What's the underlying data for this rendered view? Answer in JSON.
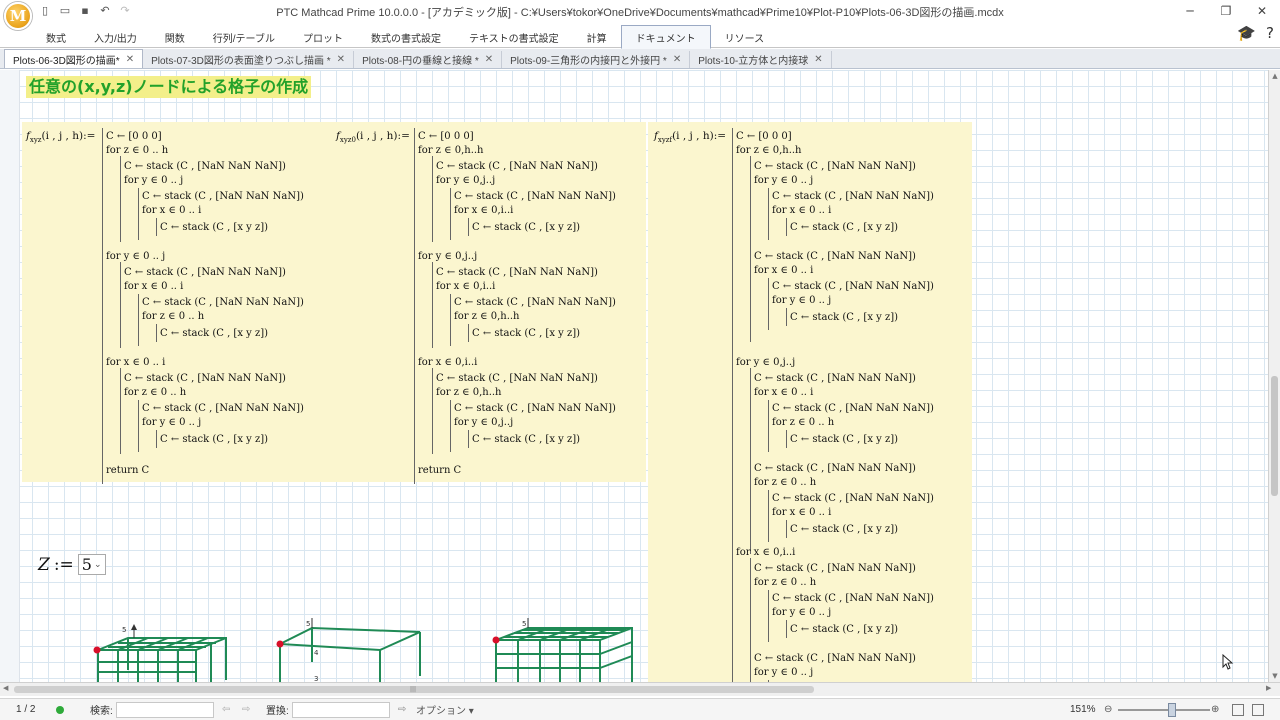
{
  "window": {
    "title": "PTC Mathcad Prime 10.0.0.0 - [アカデミック版] - C:¥Users¥tokor¥OneDrive¥Documents¥mathcad¥Prime10¥Plot-P10¥Plots-06-3D図形の描画.mcdx",
    "logo_letter": "M"
  },
  "ribbon": {
    "tabs": [
      "数式",
      "入力/出力",
      "関数",
      "行列/テーブル",
      "プロット",
      "数式の書式設定",
      "テキストの書式設定",
      "計算",
      "ドキュメント",
      "リソース"
    ],
    "active_tab": "ドキュメント"
  },
  "doc_tabs": [
    {
      "label": "Plots-06-3D図形の描画*",
      "active": true
    },
    {
      "label": "Plots-07-3D図形の表面塗りつぶし描画 *",
      "active": false
    },
    {
      "label": "Plots-08-円の垂線と接線 *",
      "active": false
    },
    {
      "label": "Plots-09-三角形の内接円と外接円 *",
      "active": false
    },
    {
      "label": "Plots-10-立方体と内接球",
      "active": false
    }
  ],
  "worksheet": {
    "heading": "任意の(x,y,z)ノードによる格子の作成",
    "functions": [
      {
        "name": "f",
        "sub": "xyz",
        "args": "(i , j , h)"
      },
      {
        "name": "f",
        "sub": "xyz0",
        "args": "(i , j , h)"
      },
      {
        "name": "f",
        "sub": "xyzf",
        "args": "(i , j , h)"
      }
    ],
    "code_tokens": {
      "assign": ":=",
      "init": "C ← [0   0   0]",
      "nan_row": "C ← stack (C , [NaN   NaN   NaN])",
      "xyz_row": "C ← stack (C , [x   y   z])",
      "return": "return C",
      "f1_for": [
        "for z ∈ 0 .. h",
        "for y ∈ 0 .. j",
        "for x ∈ 0 .. i",
        "for y ∈ 0 .. j",
        "for x ∈ 0 .. i",
        "for z ∈ 0 .. h",
        "for x ∈ 0 .. i",
        "for z ∈ 0 .. h",
        "for y ∈ 0 .. j"
      ],
      "f2_for": [
        "for z ∈ 0,h..h",
        "for y ∈ 0,j..j",
        "for x ∈ 0,i..i",
        "for y ∈ 0,j..j",
        "for x ∈ 0,i..i",
        "for z ∈ 0,h..h",
        "for x ∈ 0,i..i",
        "for z ∈ 0,h..h",
        "for y ∈ 0,j..j"
      ],
      "f3_for": [
        "for z ∈ 0,h..h",
        "for y ∈ 0 .. j",
        "for x ∈ 0 .. i",
        "for x ∈ 0 .. i",
        "for y ∈ 0 .. j",
        "for y ∈ 0,j..j",
        "for x ∈ 0 .. i",
        "for z ∈ 0 .. h",
        "for z ∈ 0 .. h",
        "for x ∈ 0 .. i",
        "for x ∈ 0,i..i",
        "for z ∈ 0 .. h",
        "for y ∈ 0 .. j",
        "for y ∈ 0 .. j",
        "for z ∈ 0 .. h"
      ]
    },
    "z_var": "Z",
    "z_value": "5",
    "plot_ticks": {
      "p1": "5",
      "p2_top": "5",
      "p2_mid": "4",
      "p2_bot": "3",
      "p3": "5"
    }
  },
  "status": {
    "page": "1 / 2",
    "search_label": "検索:",
    "search_value": "",
    "replace_label": "置換:",
    "replace_value": "",
    "options_label": "オプション",
    "zoom": "151%"
  },
  "colors": {
    "code_bg": "#fbf6cf",
    "heading_bg": "#f3ef8a",
    "heading_fg": "#22a12a",
    "plot_line": "#1f8a55",
    "plot_marker": "#d8102a"
  }
}
